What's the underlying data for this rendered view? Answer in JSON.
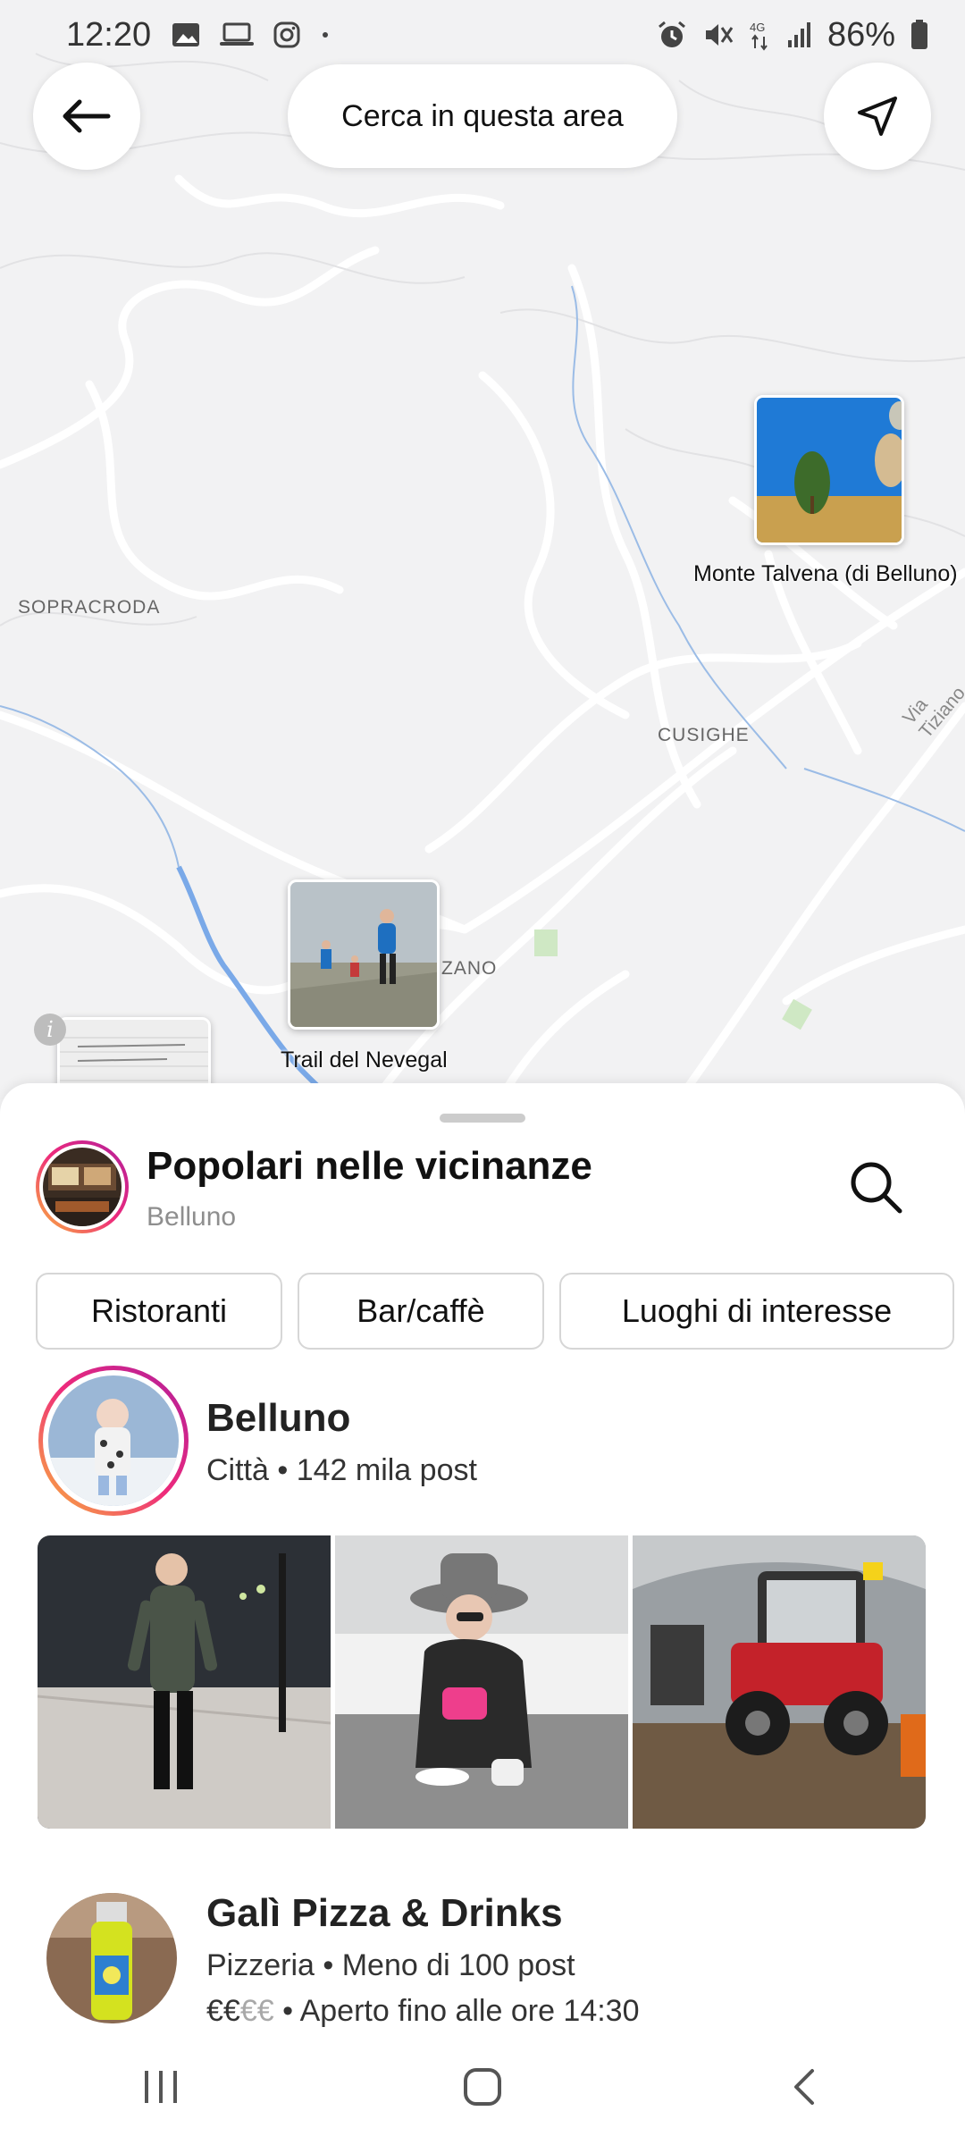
{
  "status_bar": {
    "time": "12:20",
    "battery": "86%",
    "network": "4G"
  },
  "search_area_label": "Cerca in questa area",
  "map": {
    "place_labels": [
      "SOPRACRODA",
      "CUSIGHE",
      "ZANO",
      "Via Tiziano"
    ],
    "pins": [
      {
        "caption": "Monte Talvena (di Belluno)"
      },
      {
        "caption": "Trail del Nevegal"
      }
    ]
  },
  "sheet": {
    "title": "Popolari nelle vicinanze",
    "subtitle": "Belluno",
    "filters": [
      "Ristoranti",
      "Bar/caffè",
      "Luoghi di interesse"
    ],
    "results": [
      {
        "name": "Belluno",
        "meta": "Città • 142 mila post"
      },
      {
        "name": "Galì Pizza & Drinks",
        "meta": "Pizzeria • Meno di 100 post",
        "price_active": "€€",
        "price_inactive": "€€",
        "hours": " • Aperto fino alle ore 14:30"
      }
    ]
  },
  "colors": {
    "accent_ring_start": "#f9b73b",
    "accent_ring_end": "#b01f9c",
    "river": "#7aa9e8",
    "park": "#cfe8c4"
  }
}
